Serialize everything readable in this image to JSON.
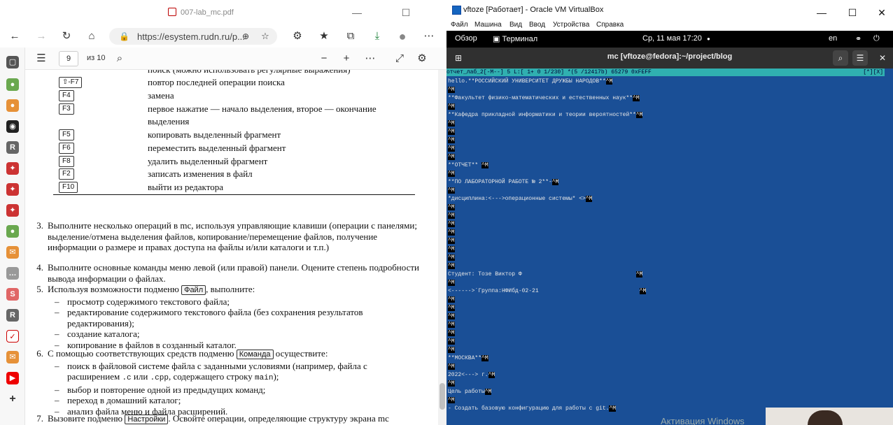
{
  "browser": {
    "tab_title": "007-lab_mc.pdf",
    "url": "https://esystem.rudn.ru/p...",
    "page_number": "9",
    "page_of": "из 10"
  },
  "doc": {
    "top_cut": "поиск (можно использовать регулярные выражения)",
    "keys": [
      {
        "key": "⇧-F7",
        "desc": "повтор последней операции поиска"
      },
      {
        "key": "F4",
        "desc": "замена"
      },
      {
        "key": "F3",
        "desc": "первое нажатие — начало выделения, второе — окончание",
        "desc2": "выделения"
      },
      {
        "key": "F5",
        "desc": "копировать выделенный фрагмент"
      },
      {
        "key": "F6",
        "desc": "переместить выделенный фрагмент"
      },
      {
        "key": "F8",
        "desc": "удалить выделенный фрагмент"
      },
      {
        "key": "F2",
        "desc": "записать изменения в файл"
      },
      {
        "key": "F10",
        "desc": "выйти из редактора"
      }
    ],
    "p3": {
      "num": "3.",
      "text": "Выполните несколько операций в mc, используя управляющие клавиши (операции с панелями; выделение/отмена выделения файлов, копирование/перемещение файлов, получение информации о размере и правах доступа на файлы и/или каталоги и т.п.)"
    },
    "p4": {
      "num": "4.",
      "text": "Выполните основные команды меню левой (или правой) панели. Оцените степень подробности вывода информации о файлах."
    },
    "p5": {
      "num": "5.",
      "pre": "Используя возможности подменю",
      "btn": "Файл",
      "post": ", выполните:",
      "items": [
        "просмотр содержимого текстового файла;",
        "редактирование содержимого текстового файла (без сохранения результатов редактирования);",
        "создание каталога;",
        "копирование в файлов в созданный каталог."
      ]
    },
    "p6": {
      "num": "6.",
      "pre": "С помощью соответствующих средств подменю",
      "btn": "Команда",
      "post": " осуществите:",
      "i1a": "поиск в файловой системе файла с заданными условиями (например, файла с расширением ",
      "i1c": ".c",
      "i1b": " или ",
      "i1d": ".cpp",
      "i1e": ", содержащего строку ",
      "i1f": "main",
      "i1g": ");",
      "items": [
        "выбор и повторение одной из предыдущих команд;",
        "переход в домашний каталог;",
        "анализ файла меню и файла расширений."
      ]
    },
    "p7": {
      "num": "7.",
      "pre": "Вызовите подменю",
      "btn": "Настройки",
      "post": ". Освойте операции, определяющие структуру экрана mc"
    }
  },
  "vbox": {
    "title": "vftoze [Работает] - Oracle VM VirtualBox",
    "menu": [
      "Файл",
      "Машина",
      "Вид",
      "Ввод",
      "Устройства",
      "Справка"
    ],
    "gnome_overview": "Обзор",
    "gnome_terminal": "Терминал",
    "clock": "Ср, 11 мая  17:20",
    "lang": "en",
    "term_title": "mc [vftoze@fedora]:~/project/blog",
    "mc_status": "отчет_лаб_2[-M--]  5 L:[  1+ 0   1/230] *(5   /12417b) 65279 0xFEFF",
    "mc_status_right": "[*][X]",
    "watermark": "Активация Windows"
  },
  "editor_lines": [
    {
      "y": 0,
      "t": "hello.**РОССИЙСКИЙ УНИВЕРСИТЕТ ДРУЖБЫ НАРОДОВ**",
      "m": "^M"
    },
    {
      "y": 1,
      "t": "",
      "m": "^M"
    },
    {
      "y": 2,
      "t": "**Факультет физико-математических и естественных наук**",
      "m": "^M"
    },
    {
      "y": 3,
      "t": "",
      "m": "^M"
    },
    {
      "y": 4,
      "t": "**Кафедра прикладной информатики и теории вероятностей**",
      "m": "^M"
    },
    {
      "y": 5,
      "t": "",
      "m": "^M"
    },
    {
      "y": 6,
      "t": "",
      "m": "^M"
    },
    {
      "y": 7,
      "t": "",
      "m": "^M"
    },
    {
      "y": 8,
      "t": "",
      "m": "^M"
    },
    {
      "y": 9,
      "t": "",
      "m": "^M"
    },
    {
      "y": 10,
      "t": "**ОТЧЕТ** ",
      "m": "^M"
    },
    {
      "y": 11,
      "t": "",
      "m": "^M"
    },
    {
      "y": 12,
      "t": "**ПО ЛАБОРАТОРНОЙ РАБОТЕ № 2**-",
      "m": "^M"
    },
    {
      "y": 13,
      "t": "",
      "m": "^M"
    },
    {
      "y": 14,
      "t": "*дисциплина:<--->операционные системы* <>",
      "m": "^M"
    },
    {
      "y": 15,
      "t": "",
      "m": "^M"
    },
    {
      "y": 16,
      "t": "",
      "m": "^M"
    },
    {
      "y": 17,
      "t": "",
      "m": "^M"
    },
    {
      "y": 18,
      "t": "",
      "m": "^M"
    },
    {
      "y": 19,
      "t": "",
      "m": "^M"
    },
    {
      "y": 20,
      "t": "",
      "m": "^M"
    },
    {
      "y": 21,
      "t": "",
      "m": "^M"
    },
    {
      "y": 22,
      "t": "",
      "m": "^M"
    },
    {
      "y": 23,
      "t": "Студент: Тозе Виктор Ф                                  ",
      "m": "^M"
    },
    {
      "y": 24,
      "t": "",
      "m": "^M"
    },
    {
      "y": 25,
      "t": "<------>`Группа:НФИбд-02-21                              ",
      "m": "^M"
    },
    {
      "y": 26,
      "t": "",
      "m": "^M"
    },
    {
      "y": 27,
      "t": "",
      "m": "^M"
    },
    {
      "y": 28,
      "t": "",
      "m": "^M"
    },
    {
      "y": 29,
      "t": "",
      "m": "^M"
    },
    {
      "y": 30,
      "t": "",
      "m": "^M"
    },
    {
      "y": 31,
      "t": "",
      "m": "^M"
    },
    {
      "y": 32,
      "t": "",
      "m": "^M"
    },
    {
      "y": 33,
      "t": "**МОСКВА**",
      "m": "^M"
    },
    {
      "y": 34,
      "t": "",
      "m": "^M"
    },
    {
      "y": 35,
      "t": "2022<---> г.",
      "m": "^M"
    },
    {
      "y": 36,
      "t": "",
      "m": "^M"
    },
    {
      "y": 37,
      "t": "Цель работы",
      "m": "^M"
    },
    {
      "y": 38,
      "t": "",
      "m": "^M"
    },
    {
      "y": 39,
      "t": "- Создать базовую конфигурацию для работы с git.",
      "m": "^M"
    }
  ]
}
